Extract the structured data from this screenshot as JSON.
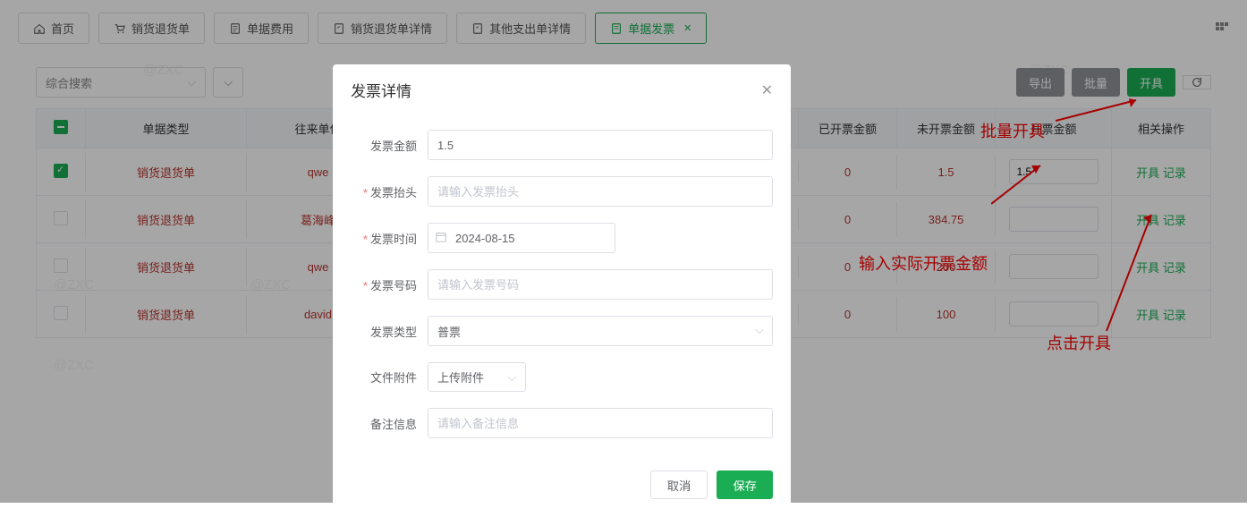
{
  "tabs": [
    {
      "label": "首页",
      "icon": "home"
    },
    {
      "label": "销货退货单",
      "icon": "cart"
    },
    {
      "label": "单据费用",
      "icon": "doc"
    },
    {
      "label": "销货退货单详情",
      "icon": "form"
    },
    {
      "label": "其他支出单详情",
      "icon": "form"
    },
    {
      "label": "单据发票",
      "icon": "receipt",
      "active": true
    }
  ],
  "search": {
    "placeholder": "综合搜索"
  },
  "toolbar": {
    "export": "导出",
    "batch": "批量",
    "issue": "开具"
  },
  "headers": {
    "type": "单据类型",
    "unit": "往来单位",
    "issued": "已开票金额",
    "unissued": "未开票金额",
    "amount": "开票金额",
    "ops": "相关操作"
  },
  "rows": [
    {
      "checked": true,
      "type": "销货退货单",
      "unit": "qwe",
      "issued": "0",
      "unissued": "1.5",
      "amount": "1.5",
      "op1": "开具",
      "op2": "记录"
    },
    {
      "checked": false,
      "type": "销货退货单",
      "unit": "葛海峰",
      "issued": "0",
      "unissued": "384.75",
      "amount": "",
      "op1": "开具",
      "op2": "记录"
    },
    {
      "checked": false,
      "type": "销货退货单",
      "unit": "qwe",
      "issued": "0",
      "unissued": "200",
      "amount": "",
      "op1": "开具",
      "op2": "记录"
    },
    {
      "checked": false,
      "type": "销货退货单",
      "unit": "david",
      "issued": "0",
      "unissued": "100",
      "amount": "",
      "op1": "开具",
      "op2": "记录"
    }
  ],
  "annotations": {
    "a1": "批量开具",
    "a2": "输入实际开票金额",
    "a3": "点击开具"
  },
  "modal": {
    "title": "发票详情",
    "labels": {
      "amount": "发票金额",
      "header": "发票抬头",
      "time": "发票时间",
      "number": "发票号码",
      "type": "发票类型",
      "file": "文件附件",
      "remark": "备注信息"
    },
    "values": {
      "amount": "1.5",
      "time": "2024-08-15",
      "type": "普票"
    },
    "placeholders": {
      "header": "请输入发票抬头",
      "number": "请输入发票号码",
      "remark": "请输入备注信息"
    },
    "upload": "上传附件",
    "cancel": "取消",
    "save": "保存"
  },
  "watermark": "@ZXC"
}
